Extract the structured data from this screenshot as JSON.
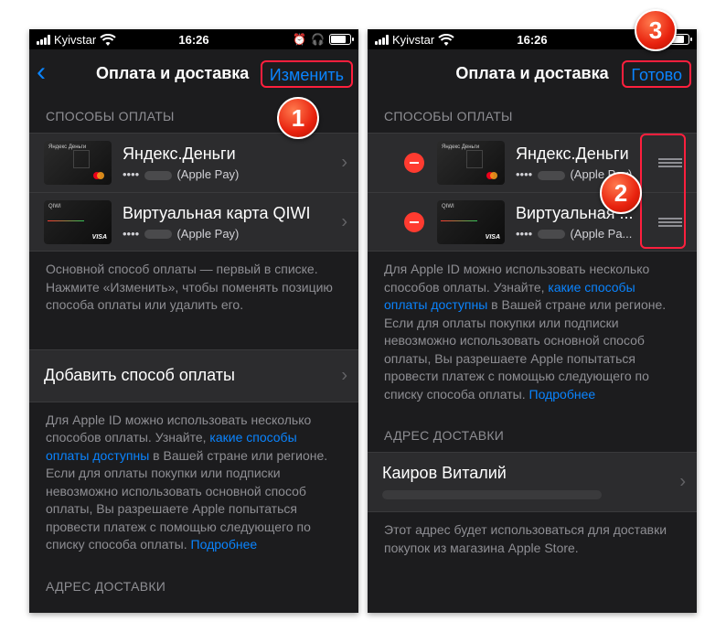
{
  "status_bar": {
    "carrier": "Kyivstar",
    "time": "16:26"
  },
  "left_screen": {
    "nav": {
      "back_icon": "‹",
      "title": "Оплата и доставка",
      "action": "Изменить"
    },
    "payment_header": "СПОСОБЫ ОПЛАТЫ",
    "cards": [
      {
        "name": "Яндекс.Деньги",
        "dots": "••••",
        "sub": "(Apple Pay)",
        "brand": "Яндекс Деньги"
      },
      {
        "name": "Виртуальная карта QIWI",
        "dots": "••••",
        "sub": "(Apple Pay)",
        "brand": "QIWI",
        "network": "VISA"
      }
    ],
    "primary_note": "Основной способ оплаты — первый в списке. Нажмите «Изменить», чтобы поменять позицию способа оплаты или удалить его.",
    "add_payment": "Добавить способ оплаты",
    "info": {
      "before_link": "Для Apple ID можно использовать несколько способов оплаты. Узнайте, ",
      "link": "какие способы оплаты доступны",
      "after_link": " в Вашей стране или регионе. Если для оплаты покупки или подписки невозможно использовать основной способ оплаты, Вы разрешаете Apple попытаться провести платеж с помощью следующего по списку способа оплаты. ",
      "more": "Подробнее"
    },
    "delivery_header": "АДРЕС ДОСТАВКИ"
  },
  "right_screen": {
    "nav": {
      "title": "Оплата и доставка",
      "action": "Готово"
    },
    "payment_header": "СПОСОБЫ ОПЛАТЫ",
    "cards": [
      {
        "name": "Яндекс.Деньги",
        "dots": "••••",
        "sub": "(Apple Pay)",
        "brand": "Яндекс Деньги"
      },
      {
        "name": "Виртуальная ...",
        "dots": "••••",
        "sub": "(Apple Pa...",
        "brand": "QIWI",
        "network": "VISA"
      }
    ],
    "info": {
      "before_link": "Для Apple ID можно использовать несколько способов оплаты. Узнайте, ",
      "link": "какие способы оплаты доступны",
      "after_link": " в Вашей стране или регионе. Если для оплаты покупки или подписки невозможно использовать основной способ оплаты, Вы разрешаете Apple попытаться провести платеж с помощью следующего по списку способа оплаты. ",
      "more": "Подробнее"
    },
    "delivery_header": "АДРЕС ДОСТАВКИ",
    "address_name": "Каиров Виталий",
    "address_note": "Этот адрес будет использоваться для доставки покупок из магазина Apple Store."
  },
  "badges": [
    "1",
    "2",
    "3"
  ],
  "colors": {
    "accent": "#0a84ff",
    "highlight": "#ff1f3d",
    "delete": "#ff3b30",
    "badge": "#e8220e"
  }
}
